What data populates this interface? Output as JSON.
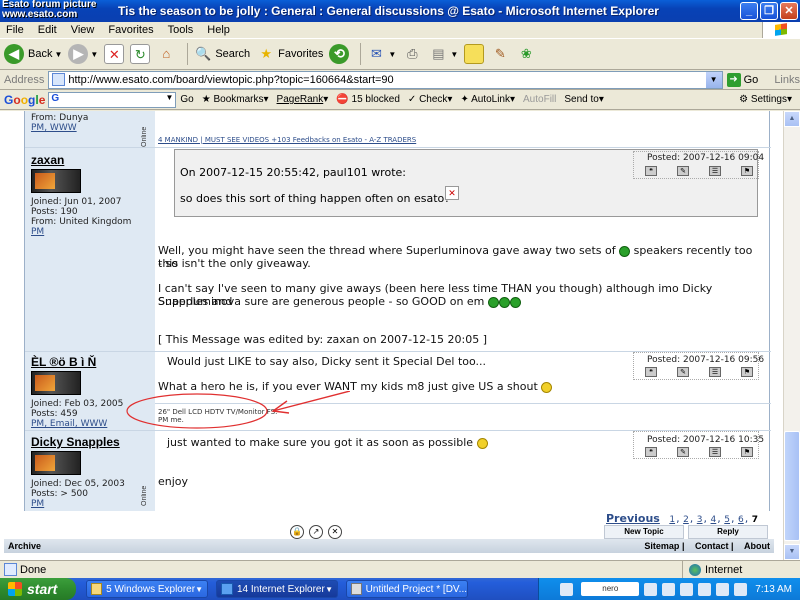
{
  "window": {
    "title": "Tis the season to be jolly : General : General discussions @ Esato - Microsoft Internet Explorer",
    "watermark_line1": "Esato forum picture",
    "watermark_line2": "www.esato.com"
  },
  "menu": [
    "File",
    "Edit",
    "View",
    "Favorites",
    "Tools",
    "Help"
  ],
  "toolbar": {
    "back": "Back",
    "search": "Search",
    "favorites": "Favorites"
  },
  "address": {
    "label": "Address",
    "url": "http://www.esato.com/board/viewtopic.php?topic=160664&start=90",
    "go": "Go",
    "links": "Links"
  },
  "google_bar": {
    "logo": "Google",
    "go": "Go",
    "bookmarks": "Bookmarks",
    "pagerank": "PageRank",
    "blocked": "15 blocked",
    "check": "Check",
    "autolink": "AutoLink",
    "autofill": "AutoFill",
    "sendto": "Send to",
    "settings": "Settings"
  },
  "prev_post": {
    "user_from": "From: Dunya",
    "links": "PM, WWW",
    "signature": "4 MANKIND | MUST SEE VIDEOS +103 Feedbacks on Esato - A-Z TRADERS",
    "online": "Online"
  },
  "posts": [
    {
      "username": "zaxan",
      "joined": "Joined: Jun 01, 2007",
      "posts": "Posts: 190",
      "from": "From: United Kingdom",
      "links": "PM",
      "posted": "Posted: 2007-12-16 09:04",
      "quote_header": "On 2007-12-15 20:55:42, paul101 wrote:",
      "quote_body": "so does this sort of thing happen often on esato?",
      "line1": "Well, you might have seen the thread where Superluminova gave away two sets of",
      "line1b": "speakers recently too - so",
      "line2": "this isn't the only giveaway.",
      "line3": "I can't say I've seen to many give aways (been here less time THAN you though) although imo Dicky Snapples and",
      "line4": "Superluminova sure are generous people - so GOOD on em",
      "edited": "[ This Message was edited by: zaxan on 2007-12-15 20:05 ]"
    },
    {
      "username": "ÈL ®ö B ì Ň",
      "joined": "Joined: Feb 03, 2005",
      "posts": "Posts: 459",
      "links": "PM, Email, WWW",
      "posted": "Posted: 2007-12-16 09:56",
      "line1": "Would just LIKE to say also, Dicky sent it Special Del too...",
      "line2": "What a hero he is, if you ever WANT my kids m8 just give US a shout",
      "sig1": "26\" Dell LCD HDTV TV/Monitor FS.",
      "sig2": "PM me."
    },
    {
      "username": "Dicky Snapples",
      "joined": "Joined: Dec 05, 2003",
      "posts": "Posts: > 500",
      "links": "PM",
      "online": "Online",
      "posted": "Posted: 2007-12-16 10:35",
      "line1": "just wanted to make sure you got it as soon as possible",
      "line2": "enjoy"
    }
  ],
  "pagination": {
    "prev": "Previous",
    "pages": [
      "1",
      "2",
      "3",
      "4",
      "5",
      "6"
    ],
    "current": "7"
  },
  "buttons": {
    "new_topic": "New Topic",
    "reply": "Reply"
  },
  "footer": {
    "archive": "Archive",
    "sitemap": "Sitemap",
    "contact": "Contact",
    "about": "About"
  },
  "status": {
    "text": "Done",
    "zone": "Internet"
  },
  "taskbar": {
    "start": "start",
    "tasks": [
      "5 Windows Explorer",
      "14 Internet Explorer",
      "Untitled Project * [DV..."
    ],
    "nero": "nero",
    "clock": "7:13 AM"
  },
  "colors": {
    "annotation": "#e03030",
    "link": "#2d4d8a",
    "user_panel": "#dfe9f3"
  }
}
